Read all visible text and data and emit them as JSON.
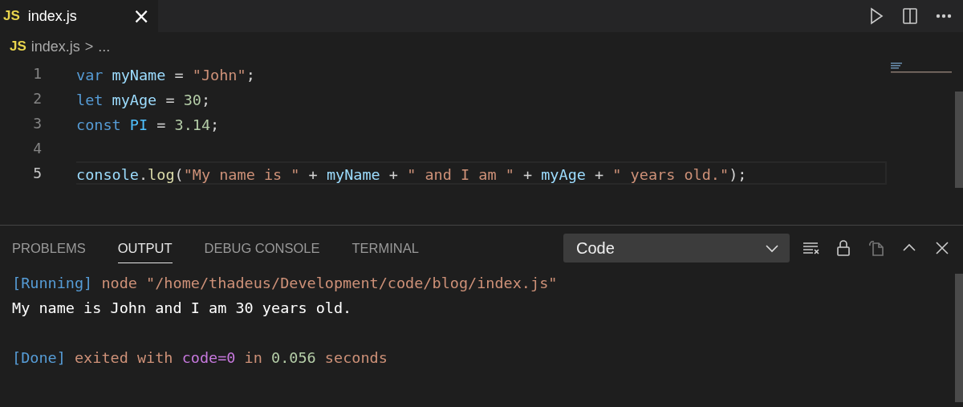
{
  "editor_tabs": [
    {
      "icon_text": "JS",
      "label": "index.js",
      "close": "×",
      "selected": true
    }
  ],
  "breadcrumb": {
    "icon_text": "JS",
    "file": "index.js",
    "separator": ">",
    "more": "..."
  },
  "code_lines": [
    {
      "number": "1",
      "current": false,
      "tokens": [
        {
          "text": "var ",
          "kind": "keyword"
        },
        {
          "text": "myName",
          "kind": "variable"
        },
        {
          "text": " = ",
          "kind": "plain"
        },
        {
          "text": "\"John\"",
          "kind": "string"
        },
        {
          "text": ";",
          "kind": "plain"
        }
      ]
    },
    {
      "number": "2",
      "current": false,
      "tokens": [
        {
          "text": "let ",
          "kind": "keyword"
        },
        {
          "text": "myAge",
          "kind": "variable"
        },
        {
          "text": " = ",
          "kind": "plain"
        },
        {
          "text": "30",
          "kind": "number"
        },
        {
          "text": ";",
          "kind": "plain"
        }
      ]
    },
    {
      "number": "3",
      "current": false,
      "tokens": [
        {
          "text": "const ",
          "kind": "keyword"
        },
        {
          "text": "PI",
          "kind": "constant"
        },
        {
          "text": " = ",
          "kind": "plain"
        },
        {
          "text": "3.14",
          "kind": "number"
        },
        {
          "text": ";",
          "kind": "plain"
        }
      ]
    },
    {
      "number": "4",
      "current": false
    },
    {
      "number": "5",
      "current": true,
      "tokens": [
        {
          "text": "console",
          "kind": "variable"
        },
        {
          "text": ".",
          "kind": "plain"
        },
        {
          "text": "log",
          "kind": "function"
        },
        {
          "text": "(",
          "kind": "plain"
        },
        {
          "text": "\"My name is \"",
          "kind": "string"
        },
        {
          "text": " + ",
          "kind": "plain"
        },
        {
          "text": "myName",
          "kind": "variable"
        },
        {
          "text": " + ",
          "kind": "plain"
        },
        {
          "text": "\" and I am \"",
          "kind": "string"
        },
        {
          "text": " + ",
          "kind": "plain"
        },
        {
          "text": "myAge",
          "kind": "variable"
        },
        {
          "text": " + ",
          "kind": "plain"
        },
        {
          "text": "\" years old.\"",
          "kind": "string"
        },
        {
          "text": ");",
          "kind": "plain"
        }
      ]
    }
  ],
  "panel": {
    "tabs": [
      {
        "label": "PROBLEMS",
        "selected": false
      },
      {
        "label": "OUTPUT",
        "selected": true
      },
      {
        "label": "DEBUG CONSOLE",
        "selected": false
      },
      {
        "label": "TERMINAL",
        "selected": false
      }
    ],
    "channel_select": {
      "value": "Code"
    },
    "output_blocks": [
      [
        [
          {
            "text": "[Running]",
            "kind": "tag"
          },
          {
            "text": " node \"/home/thadeus/Development/code/blog/index.js\"",
            "kind": "string"
          }
        ],
        [
          {
            "text": "My name is John and I am 30 years old.",
            "kind": "plain"
          }
        ]
      ],
      [
        [
          {
            "text": "[Done]",
            "kind": "tag"
          },
          {
            "text": " exited with ",
            "kind": "string"
          },
          {
            "text": "code=0",
            "kind": "purple"
          },
          {
            "text": " in ",
            "kind": "string"
          },
          {
            "text": "0.056",
            "kind": "number"
          },
          {
            "text": " seconds",
            "kind": "string"
          }
        ]
      ]
    ]
  }
}
